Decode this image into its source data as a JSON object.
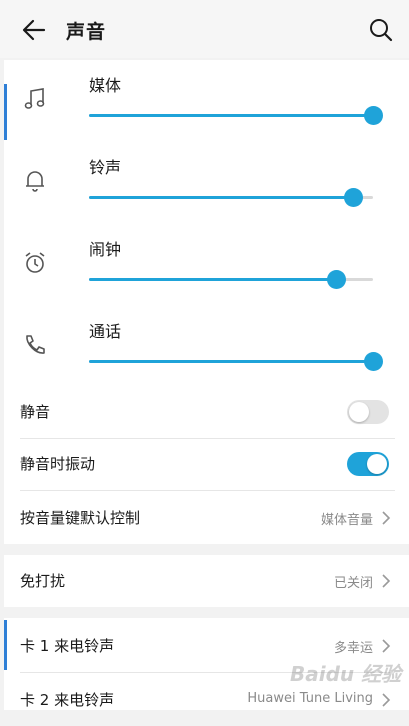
{
  "header": {
    "title": "声音"
  },
  "volumes": [
    {
      "label": "媒体",
      "icon": "music-note-icon",
      "level": 1.0
    },
    {
      "label": "铃声",
      "icon": "bell-icon",
      "level": 0.93
    },
    {
      "label": "闹钟",
      "icon": "alarm-clock-icon",
      "level": 0.87
    },
    {
      "label": "通话",
      "icon": "phone-icon",
      "level": 1.0
    }
  ],
  "settings": {
    "mute_label": "静音",
    "mute_on": false,
    "vibrate_label": "静音时振动",
    "vibrate_on": true,
    "volume_key_label": "按音量键默认控制",
    "volume_key_value": "媒体音量"
  },
  "dnd": {
    "label": "免打扰",
    "value": "已关闭"
  },
  "ringtones": [
    {
      "label": "卡 1 来电铃声",
      "value": "多幸运"
    },
    {
      "label": "卡 2 来电铃声",
      "value": "Huawei Tune Living"
    }
  ],
  "watermark": "Baidu 经验",
  "colors": {
    "accent": "#1fa3d9",
    "toggle_off": "#e3e3e3"
  }
}
